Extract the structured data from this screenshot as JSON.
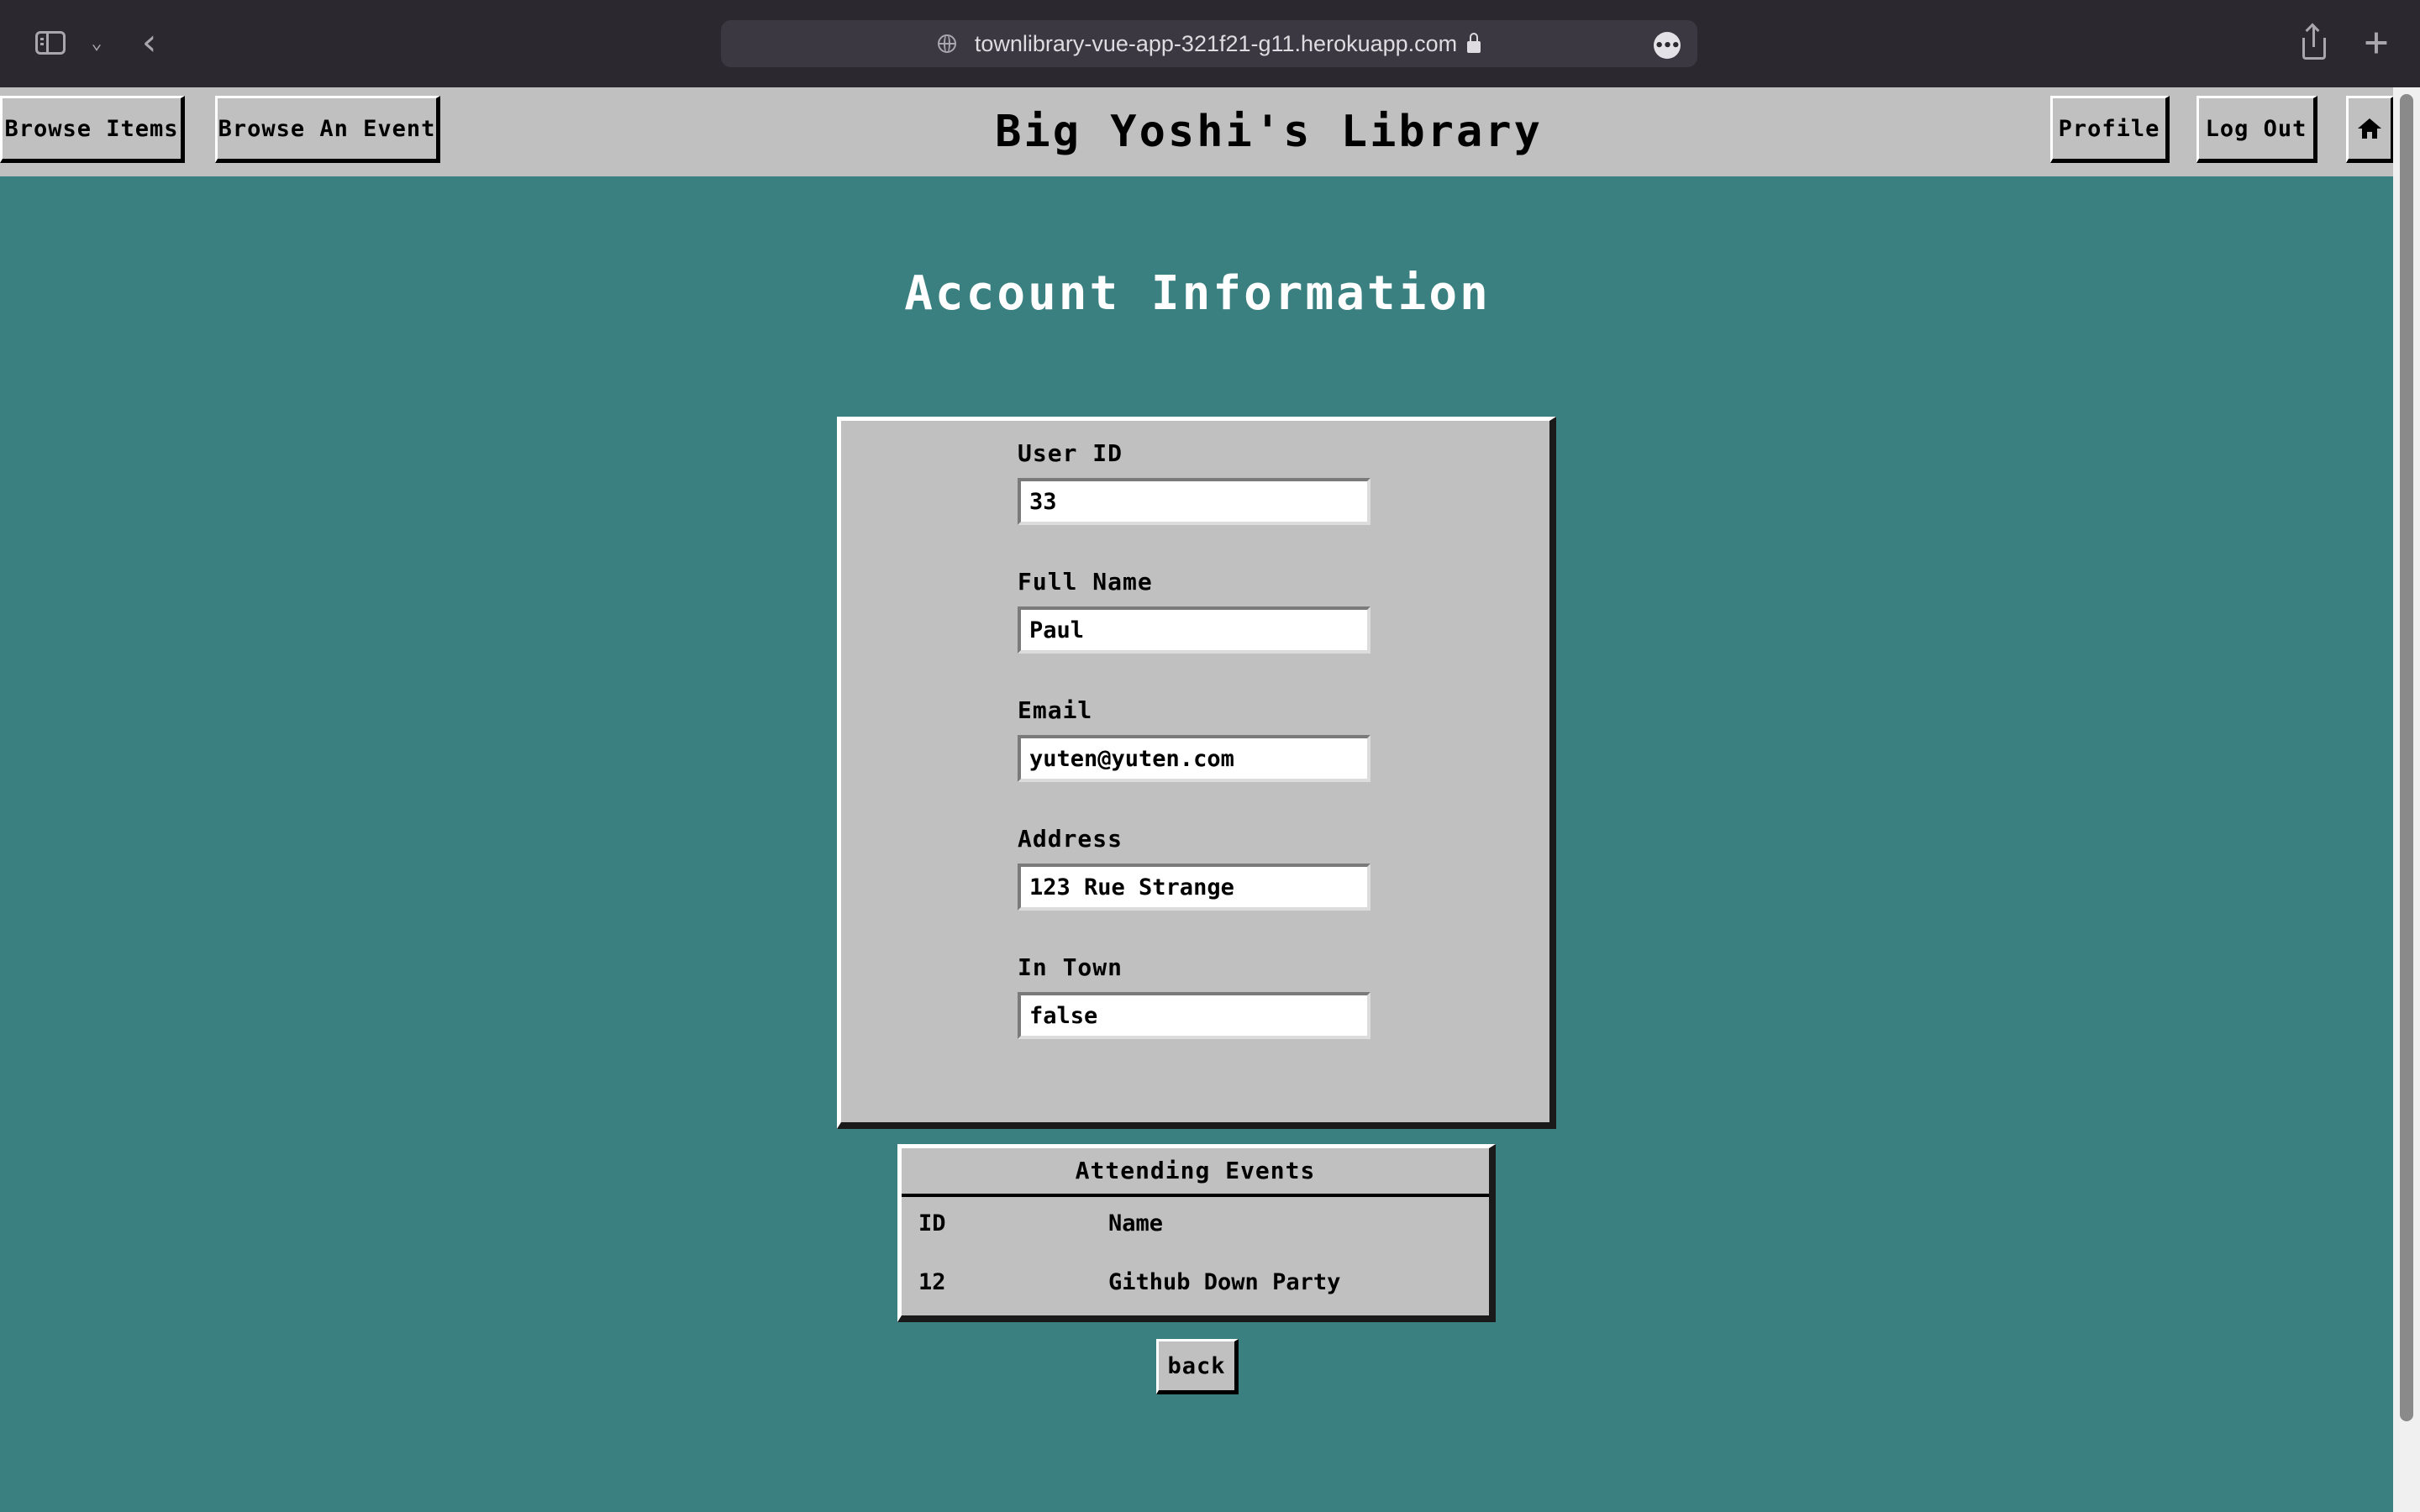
{
  "browser": {
    "url": "townlibrary-vue-app-321f21-g11.herokuapp.com",
    "icons": [
      "sidebar-icon",
      "chevron-down-icon",
      "back-icon",
      "globe-icon",
      "lock-icon",
      "more-icon",
      "share-icon",
      "plus-icon"
    ]
  },
  "nav": {
    "browse_items": "Browse Items",
    "browse_event": "Browse An Event",
    "site_title": "Big Yoshi's Library",
    "profile": "Profile",
    "logout": "Log Out",
    "home_icon": "home-icon"
  },
  "account": {
    "heading": "Account Information",
    "fields": [
      {
        "label": "User ID",
        "value": "33"
      },
      {
        "label": "Full Name",
        "value": "Paul"
      },
      {
        "label": "Email",
        "value": "yuten@yuten.com"
      },
      {
        "label": "Address",
        "value": "123 Rue Strange"
      },
      {
        "label": "In Town",
        "value": "false"
      }
    ]
  },
  "events": {
    "title": "Attending Events",
    "columns": [
      "ID",
      "Name"
    ],
    "rows": [
      {
        "id": "12",
        "name": "Github Down Party"
      }
    ]
  },
  "actions": {
    "back": "back"
  },
  "colors": {
    "background": "#3b8080",
    "panel": "#c0c0c0",
    "chrome": "#2b2830"
  }
}
